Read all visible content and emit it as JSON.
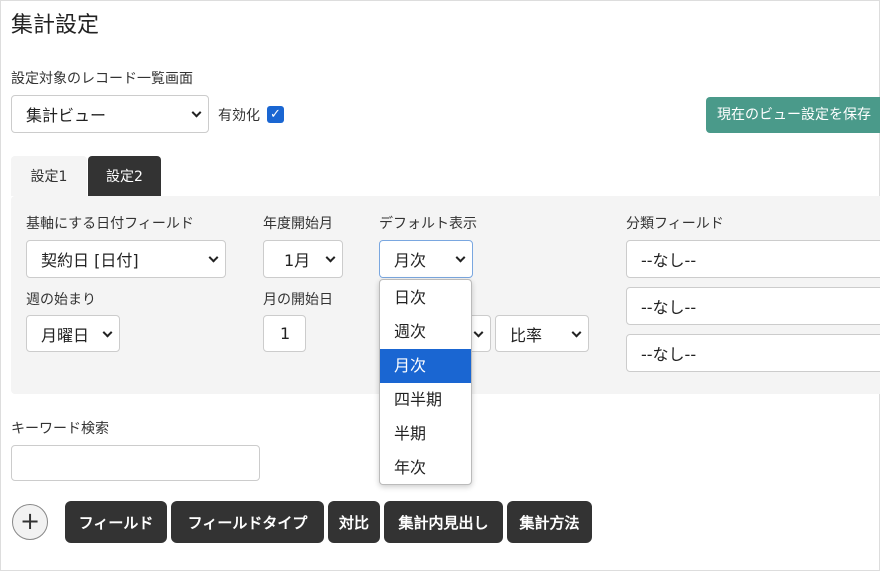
{
  "page_title": "集計設定",
  "target_label": "設定対象のレコード一覧画面",
  "view_select": "集計ビュー",
  "enable_label": "有効化",
  "enabled": true,
  "save_button": "現在のビュー設定を保存",
  "tabs": [
    {
      "label": "設定1",
      "active": false
    },
    {
      "label": "設定2",
      "active": true
    }
  ],
  "fields": {
    "date_field_label": "基軸にする日付フィールド",
    "date_field_value": "契約日 [日付]",
    "fiscal_start_label": "年度開始月",
    "fiscal_start_value": "1月",
    "default_view_label": "デフォルト表示",
    "default_view_value": "月次",
    "week_start_label": "週の始まり",
    "week_start_value": "月曜日",
    "month_start_label": "月の開始日",
    "month_start_value": "1",
    "ratio_value": "比率",
    "category_label": "分類フィールド",
    "category_values": [
      "--なし--",
      "--なし--",
      "--なし--"
    ]
  },
  "dropdown_options": [
    "日次",
    "週次",
    "月次",
    "四半期",
    "半期",
    "年次"
  ],
  "dropdown_selected": "月次",
  "keyword_label": "キーワード検索",
  "keyword_value": "",
  "bottom_buttons": [
    "フィールド",
    "フィールドタイプ",
    "対比",
    "集計内見出し",
    "集計方法"
  ],
  "colors": {
    "save": "#4a9a8a",
    "dark": "#333333",
    "selected": "#1a66d2"
  }
}
